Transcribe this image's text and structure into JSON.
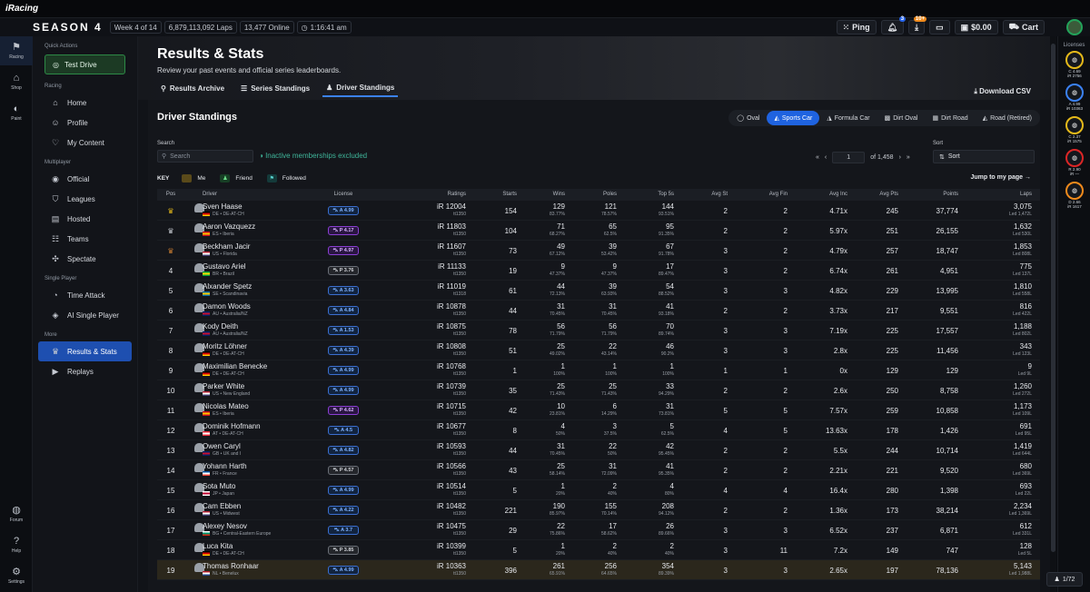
{
  "app": {
    "logo_text": "iRacing",
    "season": "SEASON 4",
    "week": "Week 4 of 14",
    "laps": "6,879,113,092 Laps",
    "online": "13,477 Online",
    "time": "1:16:41 am"
  },
  "toolbar": {
    "ping_label": "Ping",
    "notif_count": "3",
    "download_count": "10+",
    "balance": "$0.00",
    "cart_label": "Cart"
  },
  "rail": {
    "racing": "Racing",
    "shop": "Shop",
    "paint": "Paint",
    "forum": "Forum",
    "help": "Help",
    "settings": "Settings"
  },
  "sidebar": {
    "quick_actions": "Quick Actions",
    "test_drive": "Test Drive",
    "racing_header": "Racing",
    "racing_items": [
      "Home",
      "Profile",
      "My Content"
    ],
    "multiplayer_header": "Multiplayer",
    "multiplayer_items": [
      "Official",
      "Leagues",
      "Hosted",
      "Teams",
      "Spectate"
    ],
    "single_header": "Single Player",
    "single_items": [
      "Time Attack",
      "AI Single Player"
    ],
    "more_header": "More",
    "more_items": [
      "Results & Stats",
      "Replays"
    ]
  },
  "page": {
    "title": "Results & Stats",
    "subtitle": "Review your past events and official series leaderboards.",
    "tabs": [
      "Results Archive",
      "Series Standings",
      "Driver Standings"
    ],
    "download_csv": "Download CSV",
    "panel_title": "Driver Standings",
    "categories": [
      "Oval",
      "Sports Car",
      "Formula Car",
      "Dirt Oval",
      "Dirt Road",
      "Road (Retired)"
    ],
    "active_category": "Sports Car",
    "search_label": "Search",
    "search_placeholder": "Search",
    "inactive_note": "Inactive memberships excluded",
    "sort_label": "Sort",
    "sort_value": "Sort",
    "page_input": "1",
    "page_of": "of 1,458",
    "key_label": "KEY",
    "key_me": "Me",
    "key_friend": "Friend",
    "key_followed": "Followed",
    "jump_label": "Jump to my page",
    "footer_page": "1/72"
  },
  "licenses": {
    "title": "Licenses",
    "items": [
      {
        "line1": "C 4.69",
        "line2": "iR 2756",
        "color": "#e5b91a"
      },
      {
        "line1": "A 4.99",
        "line2": "iR 10363",
        "color": "#3b82f6"
      },
      {
        "line1": "C 2.37",
        "line2": "iR 1575",
        "color": "#e5b91a"
      },
      {
        "line1": "R 2.90",
        "line2": "iR —",
        "color": "#dc2626"
      },
      {
        "line1": "D 2.66",
        "line2": "iR 1617",
        "color": "#f08a1c"
      }
    ]
  },
  "table": {
    "headers": [
      "Pos",
      "Driver",
      "License",
      "Ratings",
      "Starts",
      "Wins",
      "Poles",
      "Top 5s",
      "Avg St",
      "Avg Fin",
      "Avg Inc",
      "Avg Pts",
      "Points",
      "Laps"
    ],
    "rows": [
      {
        "pos": "",
        "trophy": "#e5b91a",
        "name": "Sven Haase",
        "loc": "DE • DE-AT-CH",
        "lic": "A 4.99",
        "lt": "A",
        "ir": "iR 12004",
        "tt": "tt1350",
        "starts": "154",
        "wins": "129",
        "winsp": "83.77%",
        "poles": "121",
        "polesp": "78.57%",
        "top5": "144",
        "top5p": "93.51%",
        "avgst": "2",
        "avgfin": "2",
        "avginc": "4.71x",
        "avgpts": "245",
        "points": "37,774",
        "laps": "3,075",
        "led": "Led 1,472L",
        "flag": [
          "#000",
          "#d00",
          "#fc0"
        ]
      },
      {
        "pos": "",
        "trophy": "#c8ccd2",
        "name": "Aaron Vazquezz",
        "loc": "ES • Iberia",
        "lic": "P 4.17",
        "lt": "P",
        "ir": "iR 11803",
        "tt": "tt1350",
        "starts": "104",
        "wins": "71",
        "winsp": "68.27%",
        "poles": "65",
        "polesp": "62.5%",
        "top5": "95",
        "top5p": "91.35%",
        "avgst": "2",
        "avgfin": "2",
        "avginc": "5.97x",
        "avgpts": "251",
        "points": "26,155",
        "laps": "1,632",
        "led": "Led 530L",
        "flag": [
          "#c60b1e",
          "#ffc400",
          "#c60b1e"
        ]
      },
      {
        "pos": "",
        "trophy": "#cd7f32",
        "name": "Beckham Jacir",
        "loc": "US • Florida",
        "lic": "P 4.97",
        "lt": "P",
        "ir": "iR 11607",
        "tt": "tt1350",
        "starts": "73",
        "wins": "49",
        "winsp": "67.12%",
        "poles": "39",
        "polesp": "53.42%",
        "top5": "67",
        "top5p": "91.78%",
        "avgst": "3",
        "avgfin": "2",
        "avginc": "4.79x",
        "avgpts": "257",
        "points": "18,747",
        "laps": "1,853",
        "led": "Led 808L",
        "flag": [
          "#b22234",
          "#fff",
          "#3c3b6e"
        ]
      },
      {
        "pos": "4",
        "trophy": "",
        "name": "Gustavo Ariel",
        "loc": "BR • Brazil",
        "lic": "P 3.76",
        "lt": "R",
        "ir": "iR 11133",
        "tt": "tt1350",
        "starts": "19",
        "wins": "9",
        "winsp": "47.37%",
        "poles": "9",
        "polesp": "47.37%",
        "top5": "17",
        "top5p": "89.47%",
        "avgst": "3",
        "avgfin": "2",
        "avginc": "6.74x",
        "avgpts": "261",
        "points": "4,951",
        "laps": "775",
        "led": "Led 137L",
        "flag": [
          "#009c3b",
          "#ffdf00",
          "#009c3b"
        ]
      },
      {
        "pos": "5",
        "trophy": "",
        "name": "Alxander Spetz",
        "loc": "SE • Scandinavia",
        "lic": "A 3.63",
        "lt": "A",
        "ir": "iR 11019",
        "tt": "tt1318",
        "starts": "61",
        "wins": "44",
        "winsp": "72.13%",
        "poles": "39",
        "polesp": "63.93%",
        "top5": "54",
        "top5p": "88.52%",
        "avgst": "3",
        "avgfin": "3",
        "avginc": "4.82x",
        "avgpts": "229",
        "points": "13,995",
        "laps": "1,810",
        "led": "Led 558L",
        "flag": [
          "#006aa7",
          "#fecc00",
          "#006aa7"
        ]
      },
      {
        "pos": "6",
        "trophy": "",
        "name": "Damon Woods",
        "loc": "AU • Australia/NZ",
        "lic": "A 4.84",
        "lt": "A",
        "ir": "iR 10878",
        "tt": "tt1350",
        "starts": "44",
        "wins": "31",
        "winsp": "70.45%",
        "poles": "31",
        "polesp": "70.45%",
        "top5": "41",
        "top5p": "93.18%",
        "avgst": "2",
        "avgfin": "2",
        "avginc": "3.73x",
        "avgpts": "217",
        "points": "9,551",
        "laps": "816",
        "led": "Led 422L",
        "flag": [
          "#012169",
          "#c8102e",
          "#012169"
        ]
      },
      {
        "pos": "7",
        "trophy": "",
        "name": "Kody Deith",
        "loc": "AU • Australia/NZ",
        "lic": "A 1.53",
        "lt": "A",
        "ir": "iR 10875",
        "tt": "tt1350",
        "starts": "78",
        "wins": "56",
        "winsp": "71.79%",
        "poles": "56",
        "polesp": "71.79%",
        "top5": "70",
        "top5p": "89.74%",
        "avgst": "3",
        "avgfin": "3",
        "avginc": "7.19x",
        "avgpts": "225",
        "points": "17,557",
        "laps": "1,188",
        "led": "Led 802L",
        "flag": [
          "#012169",
          "#c8102e",
          "#012169"
        ]
      },
      {
        "pos": "8",
        "trophy": "",
        "name": "Moritz Löhner",
        "loc": "DE • DE-AT-CH",
        "lic": "A 4.39",
        "lt": "A",
        "ir": "iR 10808",
        "tt": "tt1350",
        "starts": "51",
        "wins": "25",
        "winsp": "49.02%",
        "poles": "22",
        "polesp": "43.14%",
        "top5": "46",
        "top5p": "90.2%",
        "avgst": "3",
        "avgfin": "3",
        "avginc": "2.8x",
        "avgpts": "225",
        "points": "11,456",
        "laps": "343",
        "led": "Led 123L",
        "flag": [
          "#000",
          "#d00",
          "#fc0"
        ]
      },
      {
        "pos": "9",
        "trophy": "",
        "name": "Maximilian Benecke",
        "loc": "DE • DE-AT-CH",
        "lic": "A 4.99",
        "lt": "A",
        "ir": "iR 10768",
        "tt": "tt1350",
        "starts": "1",
        "wins": "1",
        "winsp": "100%",
        "poles": "1",
        "polesp": "100%",
        "top5": "1",
        "top5p": "100%",
        "avgst": "1",
        "avgfin": "1",
        "avginc": "0x",
        "avgpts": "129",
        "points": "129",
        "laps": "9",
        "led": "Led 9L",
        "flag": [
          "#000",
          "#d00",
          "#fc0"
        ]
      },
      {
        "pos": "10",
        "trophy": "",
        "name": "Parker White",
        "loc": "US • New England",
        "lic": "A 4.99",
        "lt": "A",
        "ir": "iR 10739",
        "tt": "tt1350",
        "starts": "35",
        "wins": "25",
        "winsp": "71.43%",
        "poles": "25",
        "polesp": "71.43%",
        "top5": "33",
        "top5p": "94.29%",
        "avgst": "2",
        "avgfin": "2",
        "avginc": "2.6x",
        "avgpts": "250",
        "points": "8,758",
        "laps": "1,260",
        "led": "Led 272L",
        "flag": [
          "#b22234",
          "#fff",
          "#3c3b6e"
        ]
      },
      {
        "pos": "11",
        "trophy": "",
        "name": "Nicolas Mateo",
        "loc": "ES • Iberia",
        "lic": "P 4.62",
        "lt": "P",
        "ir": "iR 10715",
        "tt": "tt1350",
        "starts": "42",
        "wins": "10",
        "winsp": "23.81%",
        "poles": "6",
        "polesp": "14.29%",
        "top5": "31",
        "top5p": "73.81%",
        "avgst": "5",
        "avgfin": "5",
        "avginc": "7.57x",
        "avgpts": "259",
        "points": "10,858",
        "laps": "1,173",
        "led": "Led 109L",
        "flag": [
          "#c60b1e",
          "#ffc400",
          "#c60b1e"
        ]
      },
      {
        "pos": "12",
        "trophy": "",
        "name": "Dominik Hofmann",
        "loc": "AT • DE-AT-CH",
        "lic": "A 4.5",
        "lt": "A",
        "ir": "iR 10677",
        "tt": "tt1350",
        "starts": "8",
        "wins": "4",
        "winsp": "50%",
        "poles": "3",
        "polesp": "37.5%",
        "top5": "5",
        "top5p": "62.5%",
        "avgst": "4",
        "avgfin": "5",
        "avginc": "13.63x",
        "avgpts": "178",
        "points": "1,426",
        "laps": "691",
        "led": "Led 95L",
        "flag": [
          "#ed2939",
          "#fff",
          "#ed2939"
        ]
      },
      {
        "pos": "13",
        "trophy": "",
        "name": "Owen Caryl",
        "loc": "GB • UK and I",
        "lic": "A 4.82",
        "lt": "A",
        "ir": "iR 10593",
        "tt": "tt1350",
        "starts": "44",
        "wins": "31",
        "winsp": "70.45%",
        "poles": "22",
        "polesp": "50%",
        "top5": "42",
        "top5p": "95.45%",
        "avgst": "2",
        "avgfin": "2",
        "avginc": "5.5x",
        "avgpts": "244",
        "points": "10,714",
        "laps": "1,419",
        "led": "Led 644L",
        "flag": [
          "#012169",
          "#c8102e",
          "#012169"
        ]
      },
      {
        "pos": "14",
        "trophy": "",
        "name": "Yohann Harth",
        "loc": "FR • France",
        "lic": "P 4.57",
        "lt": "R",
        "ir": "iR 10566",
        "tt": "tt1350",
        "starts": "43",
        "wins": "25",
        "winsp": "58.14%",
        "poles": "31",
        "polesp": "72.09%",
        "top5": "41",
        "top5p": "95.35%",
        "avgst": "2",
        "avgfin": "2",
        "avginc": "2.21x",
        "avgpts": "221",
        "points": "9,520",
        "laps": "680",
        "led": "Led 369L",
        "flag": [
          "#0055a4",
          "#fff",
          "#ef4135"
        ]
      },
      {
        "pos": "15",
        "trophy": "",
        "name": "Sota Muto",
        "loc": "JP • Japan",
        "lic": "A 4.99",
        "lt": "A",
        "ir": "iR 10514",
        "tt": "tt1350",
        "starts": "5",
        "wins": "1",
        "winsp": "20%",
        "poles": "2",
        "polesp": "40%",
        "top5": "4",
        "top5p": "80%",
        "avgst": "4",
        "avgfin": "4",
        "avginc": "16.4x",
        "avgpts": "280",
        "points": "1,398",
        "laps": "693",
        "led": "Led 22L",
        "flag": [
          "#fff",
          "#bc002d",
          "#fff"
        ]
      },
      {
        "pos": "16",
        "trophy": "",
        "name": "Cam Ebben",
        "loc": "US • Midwest",
        "lic": "A 4.22",
        "lt": "A",
        "ir": "iR 10482",
        "tt": "tt1350",
        "starts": "221",
        "wins": "190",
        "winsp": "85.97%",
        "poles": "155",
        "polesp": "70.14%",
        "top5": "208",
        "top5p": "94.12%",
        "avgst": "2",
        "avgfin": "2",
        "avginc": "1.36x",
        "avgpts": "173",
        "points": "38,214",
        "laps": "2,234",
        "led": "Led 1,369L",
        "flag": [
          "#b22234",
          "#fff",
          "#3c3b6e"
        ]
      },
      {
        "pos": "17",
        "trophy": "",
        "name": "Alexey Nesov",
        "loc": "BG • Central-Eastern Europe",
        "lic": "A 3.7",
        "lt": "A",
        "ir": "iR 10475",
        "tt": "tt1350",
        "starts": "29",
        "wins": "22",
        "winsp": "75.86%",
        "poles": "17",
        "polesp": "58.62%",
        "top5": "26",
        "top5p": "89.66%",
        "avgst": "3",
        "avgfin": "3",
        "avginc": "6.52x",
        "avgpts": "237",
        "points": "6,871",
        "laps": "612",
        "led": "Led 331L",
        "flag": [
          "#fff",
          "#00966e",
          "#d62612"
        ]
      },
      {
        "pos": "18",
        "trophy": "",
        "name": "Luca Kita",
        "loc": "DE • DE-AT-CH",
        "lic": "P 3.85",
        "lt": "R",
        "ir": "iR 10399",
        "tt": "tt1350",
        "starts": "5",
        "wins": "1",
        "winsp": "20%",
        "poles": "2",
        "polesp": "40%",
        "top5": "2",
        "top5p": "40%",
        "avgst": "3",
        "avgfin": "11",
        "avginc": "7.2x",
        "avgpts": "149",
        "points": "747",
        "laps": "128",
        "led": "Led 5L",
        "flag": [
          "#000",
          "#d00",
          "#fc0"
        ]
      },
      {
        "pos": "19",
        "trophy": "",
        "name": "Thomas Ronhaar",
        "loc": "NL • Benelux",
        "lic": "A 4.99",
        "lt": "A",
        "ir": "iR 10363",
        "tt": "tt1350",
        "starts": "396",
        "wins": "261",
        "winsp": "65.91%",
        "poles": "256",
        "polesp": "64.65%",
        "top5": "354",
        "top5p": "89.39%",
        "avgst": "3",
        "avgfin": "3",
        "avginc": "2.65x",
        "avgpts": "197",
        "points": "78,136",
        "laps": "5,143",
        "led": "Led 1,988L",
        "flag": [
          "#ae1c28",
          "#fff",
          "#21468b"
        ],
        "me": true
      }
    ]
  }
}
